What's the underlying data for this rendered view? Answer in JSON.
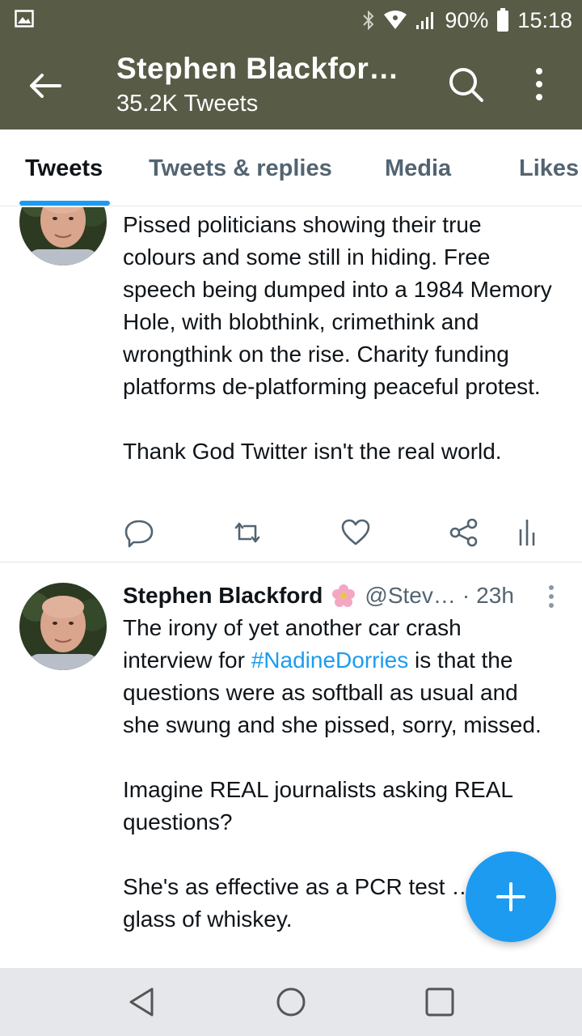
{
  "status_bar": {
    "battery_percent": "90%",
    "time": "15:18",
    "icons": [
      "image-icon",
      "bluetooth-icon",
      "wifi-icon",
      "signal-icon",
      "battery-icon"
    ]
  },
  "header": {
    "title": "Stephen Blackfor…",
    "subtitle": "35.2K Tweets",
    "background_color": "#585b46"
  },
  "tabs": [
    {
      "label": "Tweets",
      "active": true
    },
    {
      "label": "Tweets & replies",
      "active": false
    },
    {
      "label": "Media",
      "active": false
    },
    {
      "label": "Likes",
      "active": false
    }
  ],
  "tweets": [
    {
      "paragraphs": [
        "Pissed politicians showing their true colours and some still in hiding. Free speech being dumped into a 1984 Memory Hole, with blobthink, crimethink and wrongthink on the rise. Charity funding platforms de-platforming peaceful protest.",
        "Thank God Twitter isn't the real world."
      ]
    },
    {
      "author_name": "Stephen Blackford",
      "handle": "@Stev…",
      "separator": "·",
      "time": "23h",
      "paragraph1_before": "The irony of yet another car crash interview for ",
      "hashtag": "#NadineDorries",
      "paragraph1_after": " is that the questions were as softball as usual and she swung and she pissed, sorry, missed.",
      "paragraph2": "Imagine REAL journalists asking REAL questions?",
      "paragraph3": "She's as effective as a PCR test … in a glass of whiskey."
    }
  ],
  "accent_color": "#1d9bf0"
}
